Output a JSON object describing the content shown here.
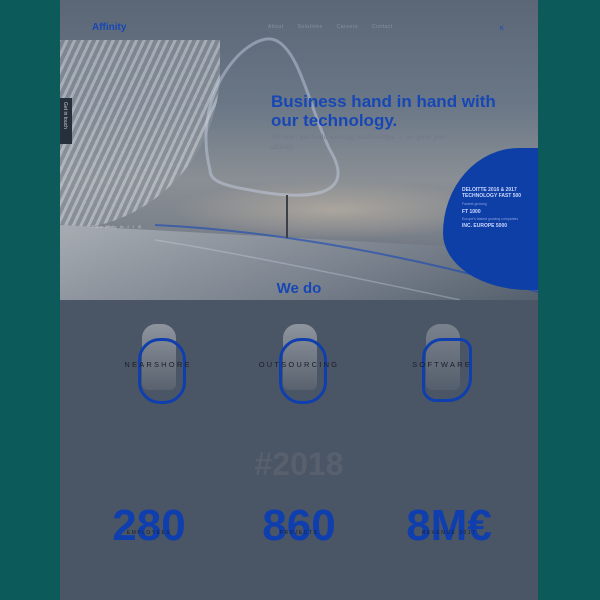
{
  "header": {
    "logo": "Affinity",
    "nav": [
      "About",
      "Solutions",
      "Careers",
      "Contact"
    ],
    "lang": "K"
  },
  "side_tab": {
    "label": "Get in touch"
  },
  "hero": {
    "headline": "Business hand in hand with our technology.",
    "subline": "We don't just build working relationships — we grow pure affinity.",
    "follow_label": "Follow Affinity"
  },
  "awards": [
    {
      "title": "DELOITTE 2016 & 2017 TECHNOLOGY FAST 500",
      "sub": "Fastest growing"
    },
    {
      "title": "FT 1000",
      "sub": "Europe's fastest growing companies"
    },
    {
      "title": "INC. EUROPE 5000",
      "sub": ""
    }
  ],
  "we_do": {
    "title": "We do",
    "services": [
      "NEARSHORE",
      "OUTSOURCING",
      "SOFTWARE"
    ]
  },
  "stats": {
    "year": "#2018",
    "items": [
      {
        "value": "280",
        "label": "EMPLOYEES"
      },
      {
        "value": "860",
        "label": "PROJECTS"
      },
      {
        "value": "8M€",
        "label": "REVENUE 2017"
      }
    ]
  },
  "colors": {
    "accent": "#1747b5",
    "blob": "#0d3fa6",
    "teal_frame": "#0c5a5a"
  }
}
